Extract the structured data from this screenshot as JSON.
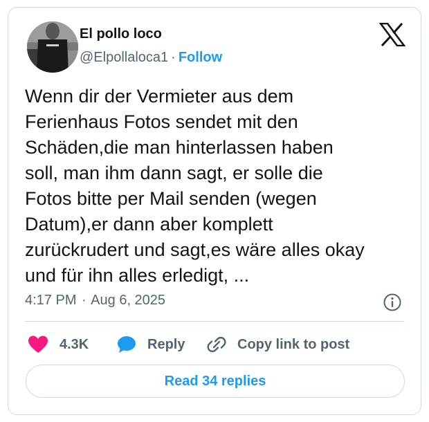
{
  "author": {
    "name": "El pollo loco",
    "handle": "@Elpollaloca1",
    "separator": "·",
    "follow_label": "Follow",
    "avatar_icon": "profile-photo"
  },
  "tweet": {
    "text": "Wenn dir der Vermieter aus dem\nFerienhaus Fotos sendet mit den\nSchäden,die man hinterlassen haben\nsoll, man ihm dann sagt, er solle die\nFotos bitte per Mail senden (wegen\nDatum),er dann aber komplett\nzurückrudert und sagt,es wäre alles okay\nund für ihn alles erledigt, ...",
    "time": "4:17 PM",
    "separator": "·",
    "date": "Aug 6, 2025"
  },
  "actions": {
    "likes_count": "4.3K",
    "reply_label": "Reply",
    "copy_label": "Copy link to post"
  },
  "read_replies_label": "Read 34 replies",
  "colors": {
    "accent": "#1d9bf0",
    "like": "#f91880",
    "text": "#0f1419",
    "muted": "#536471",
    "border": "#cfd9de"
  },
  "icons": [
    "x-logo-icon",
    "info-icon",
    "heart-icon",
    "reply-bubble-icon",
    "link-icon"
  ]
}
